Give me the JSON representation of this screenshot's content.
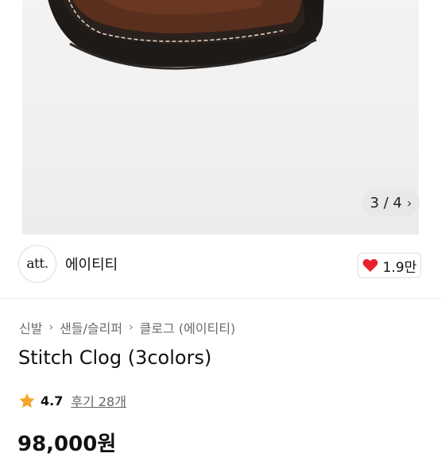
{
  "gallery": {
    "counter": "3 / 4",
    "chevron": "›"
  },
  "seller": {
    "logo_text": "att.",
    "name": "에이티티",
    "like_count": "1.9만"
  },
  "breadcrumb": {
    "items": [
      "신발",
      "샌들/슬리퍼",
      "클로그 (에이티티)"
    ],
    "separator": "›"
  },
  "product": {
    "title": "Stitch Clog (3colors)",
    "rating": "4.7",
    "reviews": "후기 28개",
    "price": "98,000원"
  },
  "colors": {
    "heart": "#e8202e",
    "star": "#f4a52a"
  }
}
